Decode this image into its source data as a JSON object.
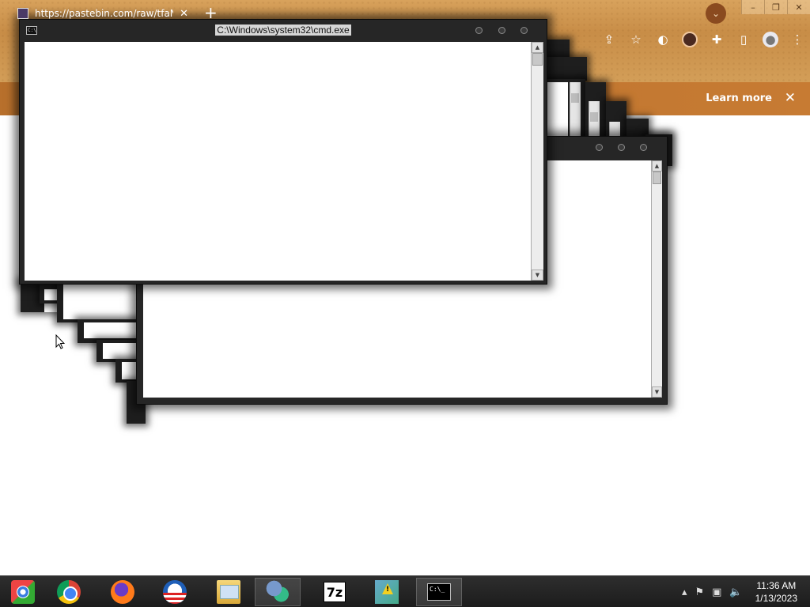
{
  "browser": {
    "tab_title": "https://pastebin.com/raw/tfaN",
    "tab_close": "✕",
    "new_tab": "+",
    "tab_search": "⌄",
    "window_controls": {
      "minimize": "–",
      "restore": "❐",
      "close": "✕"
    },
    "toolbar_icons": {
      "share": "share-icon",
      "star": "☆",
      "extensions": "puzzle-icon",
      "sidepanel": "▯",
      "menu": "⋮"
    },
    "banner": {
      "learn_more": "Learn more",
      "close": "✕"
    }
  },
  "cmd_window": {
    "title": "C:\\Windows\\system32\\cmd.exe",
    "icon_text": "C:\\",
    "scroll_up": "▲",
    "scroll_down": "▼"
  },
  "taskbar": {
    "apps": [
      {
        "name": "start",
        "label": ""
      },
      {
        "name": "chrome",
        "label": ""
      },
      {
        "name": "firefox",
        "label": ""
      },
      {
        "name": "obama",
        "label": ""
      },
      {
        "name": "file-explorer",
        "label": ""
      },
      {
        "name": "msn-messenger",
        "label": ""
      },
      {
        "name": "7zip",
        "label": "7z"
      },
      {
        "name": "warning-app",
        "label": ""
      },
      {
        "name": "cmd",
        "label": "C:\\_"
      }
    ],
    "tray": {
      "expand": "▴",
      "flag": "⚑",
      "network": "▣",
      "volume": "🔈"
    },
    "clock": {
      "time": "11:36 AM",
      "date": "1/13/2023"
    }
  }
}
